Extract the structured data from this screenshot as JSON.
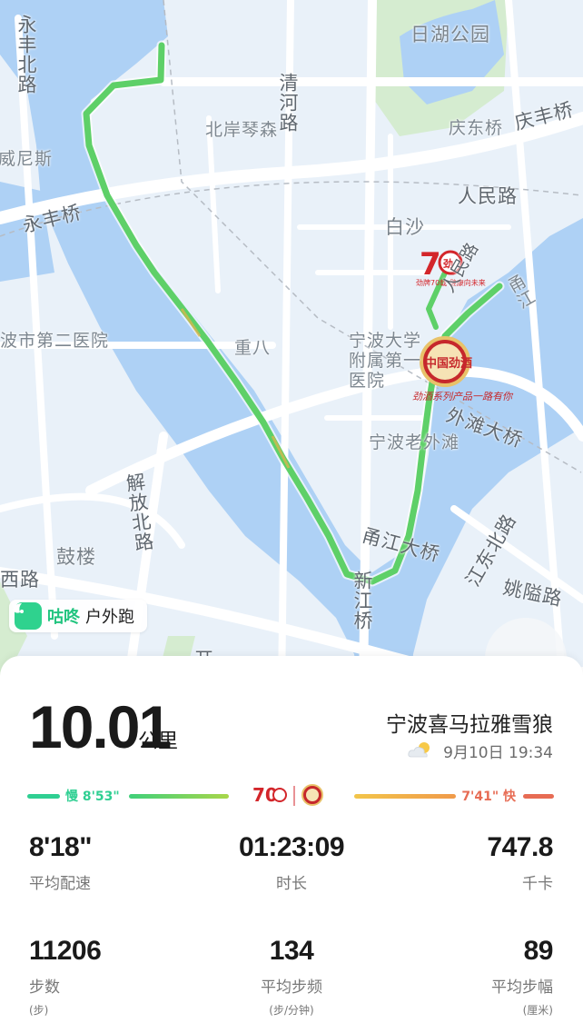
{
  "map": {
    "labels": {
      "rihu_park": "日湖公园",
      "yongfeng_north": "永丰北路",
      "qinghe": "清河路",
      "beian_qinsen": "北岸琴森",
      "qingdong": "庆东桥",
      "qingfeng_bridge": "庆丰桥",
      "venice": "威尼斯",
      "yongfeng_bridge": "永丰桥",
      "renmin_road": "人民路",
      "baisha": "白沙",
      "renmin_road_v": "人民路",
      "yongjiang": "甬江",
      "hospital2": "波市第二医院",
      "zhongba": "重八",
      "univ_hospital": "宁波大学附属第一医院",
      "waitan_bridge": "外滩大桥",
      "old_waitan": "宁波老外滩",
      "jiefang_north": "解放北路",
      "gulou": "鼓楼",
      "yongjiang_bridge": "甬江大桥",
      "jiangdong_north": "江东北路",
      "yaoai_road": "姚隘路",
      "xi_road": "西路",
      "xinjiang_bridge": "新江桥",
      "kai": "开"
    },
    "sponsor_70": "70",
    "sponsor_70_caption": "劲牌70载 健康向未来",
    "sponsor_jiu": "中国劲酒",
    "sponsor_jiu_caption": "劲酒系列产品一路有你"
  },
  "app": {
    "name": "咕咚",
    "sport_type": "户外跑",
    "logo_icon": "gudong-logo-icon",
    "accent": "#2fd28e"
  },
  "summary": {
    "distance": "10.01",
    "distance_unit": "公里",
    "user_name": "宁波喜马拉雅雪狼",
    "weather_icon": "partly-cloudy-icon",
    "date": "9月10日 19:34"
  },
  "pace_legend": {
    "slow_label": "慢 8'53\"",
    "fast_label": "7'41\" 快",
    "slow_color": "#2fcf92",
    "fast_color": "#e76c54"
  },
  "stats": [
    {
      "value": "8'18\"",
      "label": "平均配速",
      "sub": ""
    },
    {
      "value": "01:23:09",
      "label": "时长",
      "sub": ""
    },
    {
      "value": "747.8",
      "label": "千卡",
      "sub": ""
    },
    {
      "value": "11206",
      "label": "步数",
      "sub": "(步)"
    },
    {
      "value": "134",
      "label": "平均步频",
      "sub": "(步/分钟)"
    },
    {
      "value": "89",
      "label": "平均步幅",
      "sub": "(厘米)"
    }
  ]
}
